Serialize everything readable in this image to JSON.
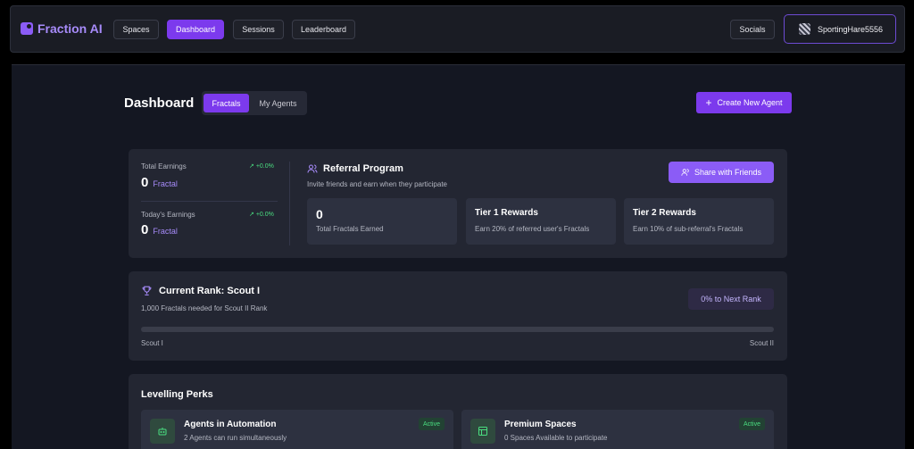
{
  "brand": {
    "name": "Fraction AI"
  },
  "nav": {
    "spaces": "Spaces",
    "dashboard": "Dashboard",
    "sessions": "Sessions",
    "leaderboard": "Leaderboard",
    "socials": "Socials",
    "username": "SportingHare5556"
  },
  "page": {
    "title": "Dashboard",
    "tabs": [
      "Fractals",
      "My Agents"
    ],
    "active_tab": "Fractals",
    "create_button": "Create New Agent"
  },
  "earnings": {
    "total_label": "Total Earnings",
    "total_delta": "+0.0%",
    "total_value": "0",
    "total_unit": "Fractal",
    "today_label": "Today's Earnings",
    "today_delta": "+0.0%",
    "today_value": "0",
    "today_unit": "Fractal"
  },
  "referral": {
    "title": "Referral Program",
    "subtitle": "Invite friends and earn when they participate",
    "share_button": "Share with Friends",
    "total_value": "0",
    "total_label": "Total Fractals Earned",
    "tier1_title": "Tier 1 Rewards",
    "tier1_desc": "Earn 20% of referred user's Fractals",
    "tier2_title": "Tier 2 Rewards",
    "tier2_desc": "Earn 10% of sub-referral's Fractals"
  },
  "rank": {
    "title": "Current Rank: Scout I",
    "subtitle": "1,000 Fractals needed for Scout II Rank",
    "next_rank_pill": "0% to Next Rank",
    "progress_fraction": 0,
    "start_label": "Scout I",
    "end_label": "Scout II"
  },
  "perks": {
    "title": "Levelling Perks",
    "items": [
      {
        "title": "Agents in Automation",
        "desc": "2 Agents can run simultaneously",
        "badge": "Active",
        "icon": "robot-icon"
      },
      {
        "title": "Premium Spaces",
        "desc": "0 Spaces Available to participate",
        "badge": "Active",
        "icon": "layout-icon"
      }
    ]
  },
  "colors": {
    "accent": "#7c3aed",
    "accent_light": "#8b5cf6",
    "positive": "#4ade80",
    "background": "#141722",
    "card": "#232632"
  }
}
